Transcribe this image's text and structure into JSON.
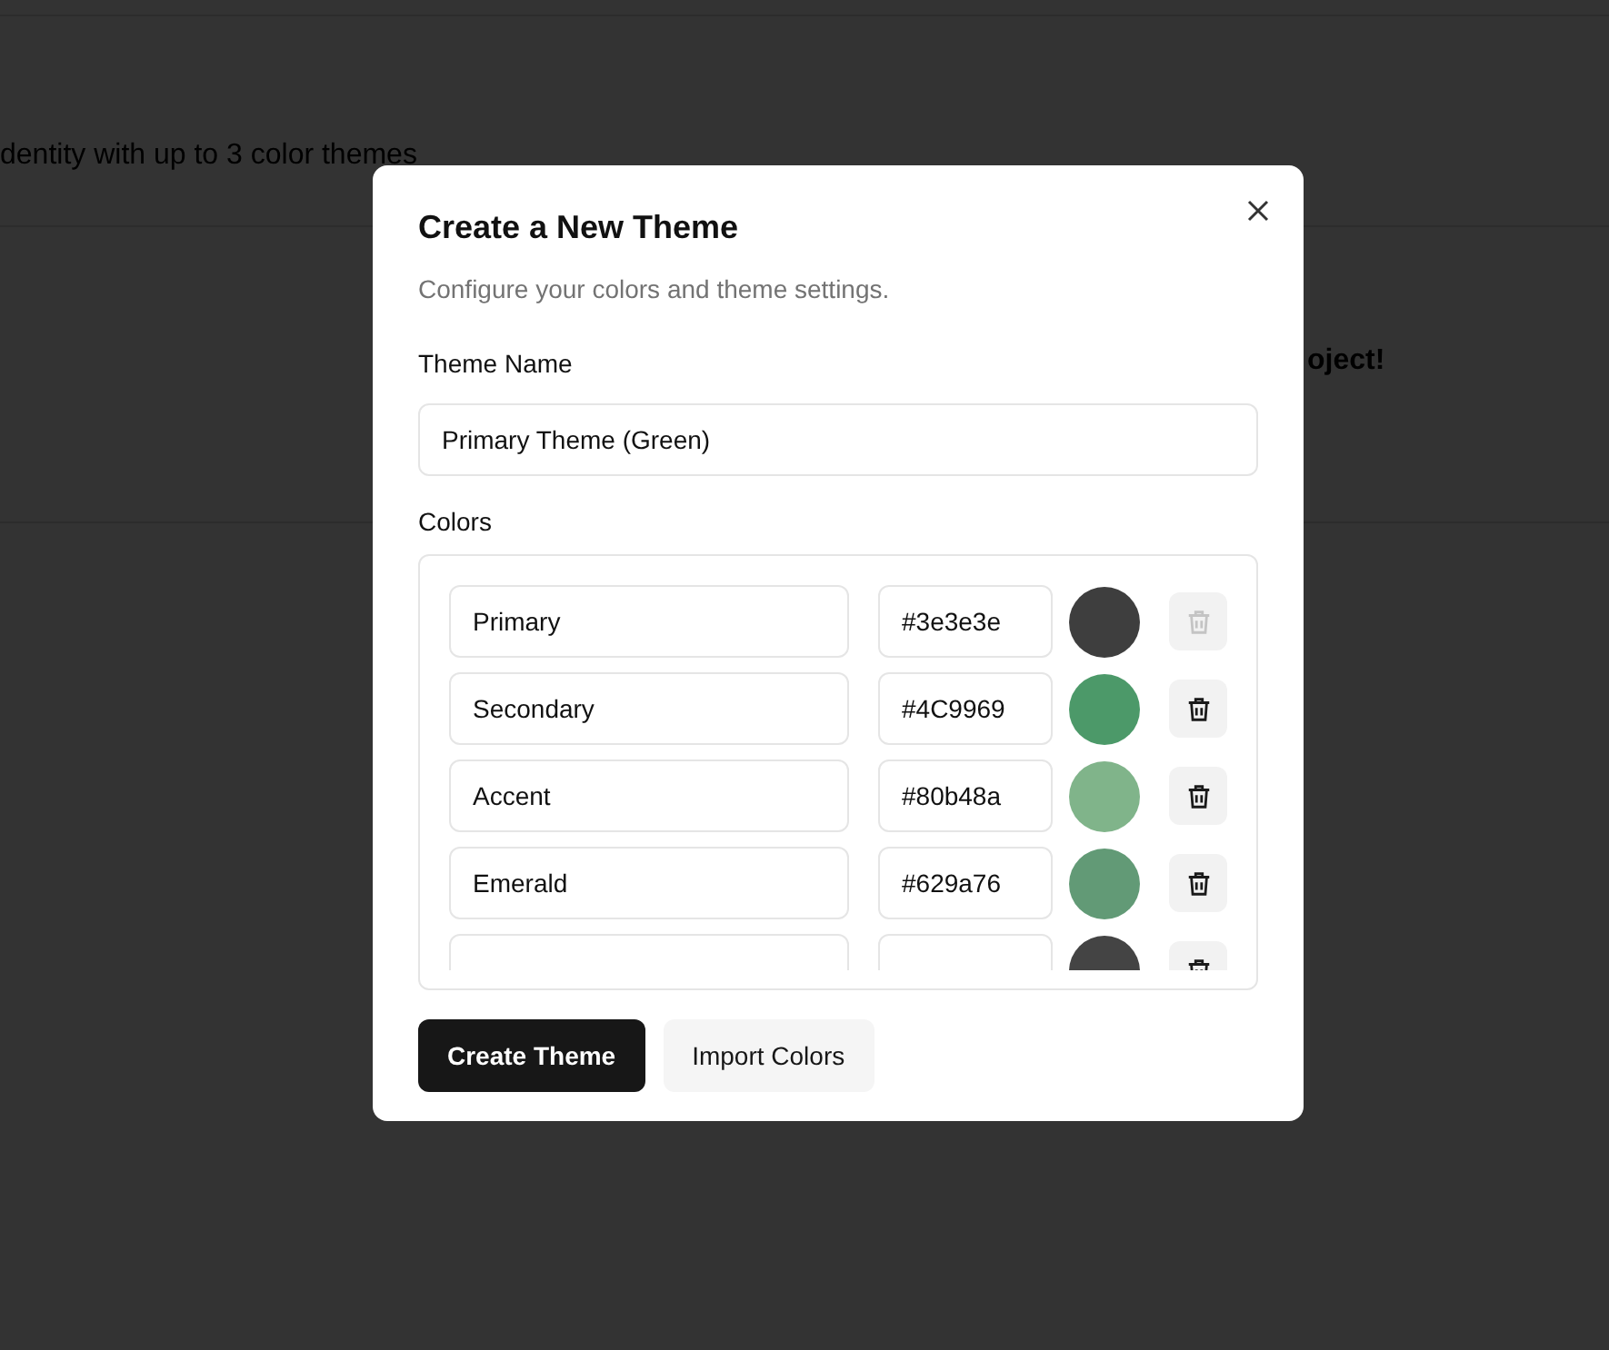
{
  "background": {
    "subtitle": "dentity with up to 3 color themes",
    "note": "oject!"
  },
  "dialog": {
    "title": "Create a New Theme",
    "description": "Configure your colors and theme settings.",
    "theme_name": {
      "label": "Theme Name",
      "value": "Primary Theme (Green)"
    },
    "colors_label": "Colors",
    "colors": [
      {
        "name": "Primary",
        "hex": "#3e3e3e",
        "color": "#3e3e3e",
        "disabled": true
      },
      {
        "name": "Secondary",
        "hex": "#4C9969",
        "color": "#4c9969",
        "disabled": false
      },
      {
        "name": "Accent",
        "hex": "#80b48a",
        "color": "#80b48a",
        "disabled": false
      },
      {
        "name": "Emerald",
        "hex": "#629a76",
        "color": "#629a76",
        "disabled": false
      },
      {
        "color": "#444444",
        "disabled": false
      }
    ],
    "buttons": [
      {
        "label": "Create Theme",
        "kind": "primary"
      },
      {
        "label": "Import Colors",
        "kind": "secondary"
      }
    ]
  }
}
